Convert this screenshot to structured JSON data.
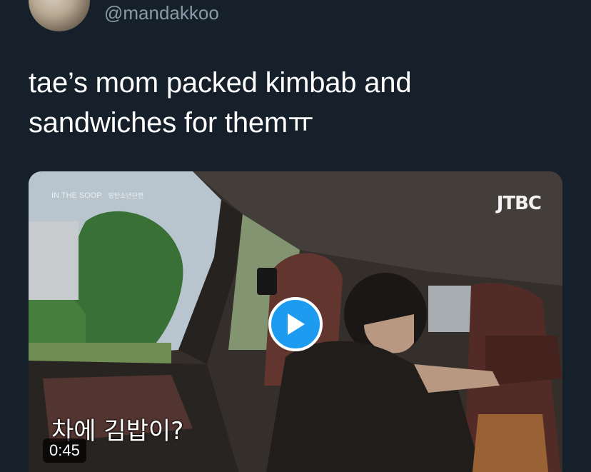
{
  "tweet": {
    "handle": "@mandakkoo",
    "text_line1": "tae’s mom packed kimbab and",
    "text_line2": "sandwiches for themㅠ"
  },
  "media": {
    "broadcaster": "JTBC",
    "show_title": "IN THE SOOP",
    "show_subtitle": "방탄소년단편",
    "caption": "차에 김밥이?",
    "duration": "0:45",
    "play_icon": "play-icon"
  },
  "colors": {
    "background": "#15202b",
    "handle": "#8b98a5",
    "play_button": "#1d9bf0"
  }
}
